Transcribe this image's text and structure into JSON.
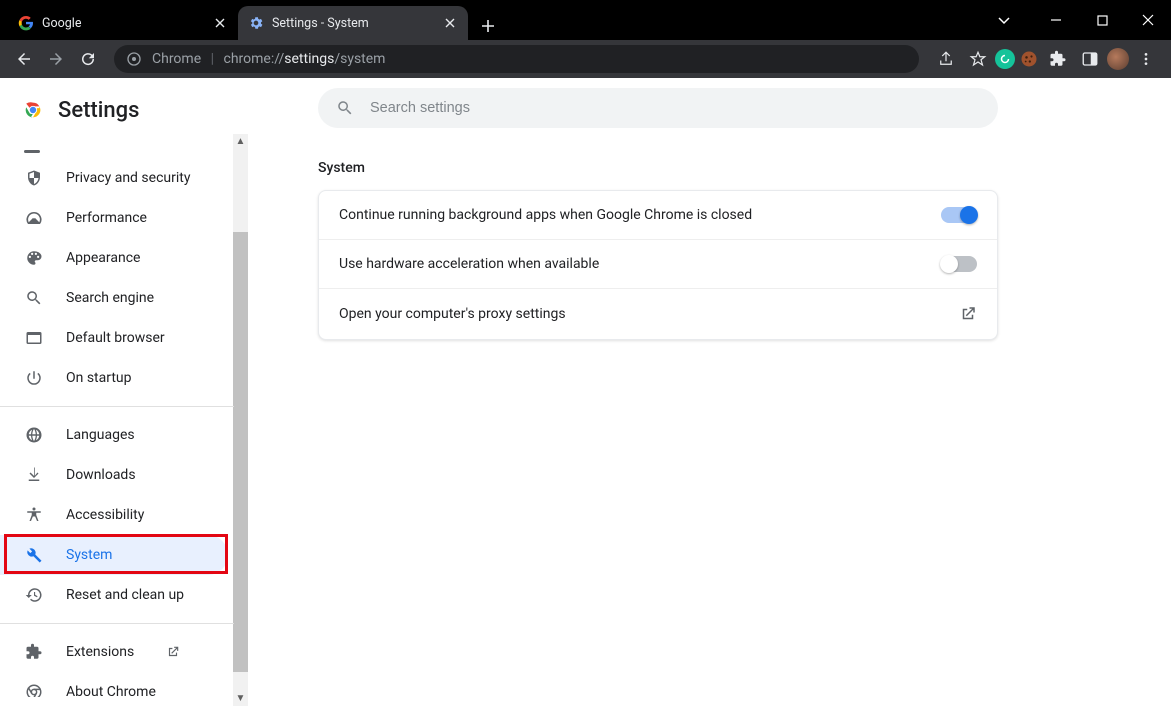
{
  "titlebar": {
    "tabs": [
      {
        "title": "Google",
        "active": false
      },
      {
        "title": "Settings - System",
        "active": true
      }
    ]
  },
  "toolbar": {
    "omnibox": {
      "origin_label": "Chrome",
      "scheme": "chrome://",
      "path_bold": "settings",
      "path_tail": "/system"
    }
  },
  "sidebar": {
    "title": "Settings",
    "items": {
      "privacy": "Privacy and security",
      "performance": "Performance",
      "appearance": "Appearance",
      "search_engine": "Search engine",
      "default_browser": "Default browser",
      "on_startup": "On startup",
      "languages": "Languages",
      "downloads": "Downloads",
      "accessibility": "Accessibility",
      "system": "System",
      "reset": "Reset and clean up",
      "extensions": "Extensions",
      "about": "About Chrome"
    }
  },
  "main": {
    "search_placeholder": "Search settings",
    "section_title": "System",
    "rows": {
      "bg_apps": "Continue running background apps when Google Chrome is closed",
      "hw_accel": "Use hardware acceleration when available",
      "proxy": "Open your computer's proxy settings"
    },
    "toggles": {
      "bg_apps": true,
      "hw_accel": false
    }
  }
}
